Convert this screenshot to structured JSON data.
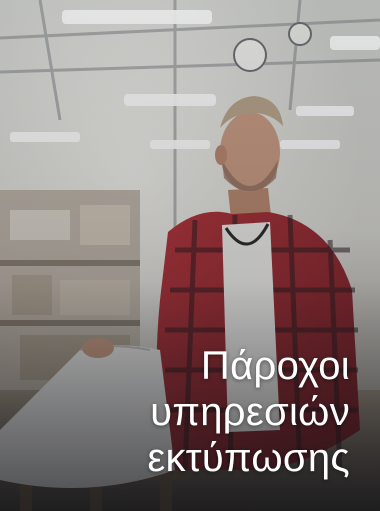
{
  "card": {
    "title_lines": [
      "Πάροχοι",
      "υπηρεσιών",
      "εκτύπωσης"
    ]
  },
  "photo": {
    "subject": "printing-professional-photo",
    "colors": {
      "warehouse_light": "#dcdcd6",
      "shirt_red": "#a52a2f",
      "shirt_dark": "#2b1b1f",
      "skin": "#c79a82",
      "paper": "#e7e7e5"
    }
  }
}
